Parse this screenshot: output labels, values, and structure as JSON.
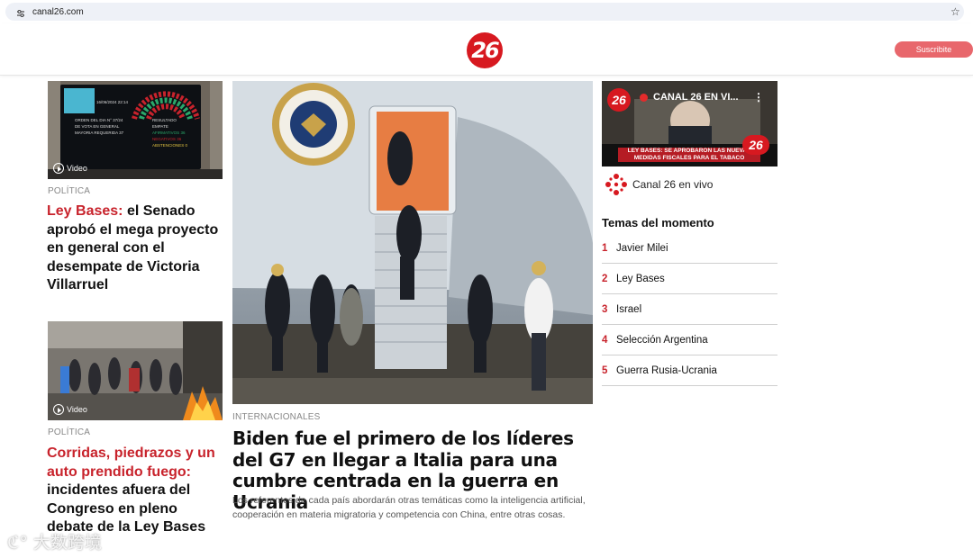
{
  "browser": {
    "url": "canal26.com"
  },
  "header": {
    "logo_text": "26",
    "subscribe_label": "Suscribite"
  },
  "left_cards": [
    {
      "video_label": "Video",
      "section": "POLÍTICA",
      "headline_red": "Ley Bases:",
      "headline_rest": " el Senado aprobó el mega proyecto en general con el desempate de Victoria Villarruel",
      "screen_lines": [
        "16/06/2024 22:14",
        "ORDEN DEL DIA N° 37/24",
        "DE VOTA EN GENERAL",
        "MAYORIA REQUERIDA 37",
        "RESULTADO",
        "EMPATE",
        "AFIRMATIVOS",
        "NEGATIVOS",
        "ABSTENCIONES",
        "36",
        "36",
        "0"
      ]
    },
    {
      "video_label": "Video",
      "section": "POLÍTICA",
      "headline_red": "Corridas, piedrazos y un auto prendido fuego:",
      "headline_rest": " incidentes afuera del Congreso en pleno debate de la Ley Bases"
    }
  ],
  "main_story": {
    "section": "INTERNACIONALES",
    "headline": "Biden fue el primero de los líderes del G7 en llegar a Italia para una cumbre centrada en la guerra en Ucrania",
    "excerpt": "Los referentes de cada país abordarán otras temáticas como la inteligencia artificial, cooperación en materia migratoria y competencia con China, entre otras cosas."
  },
  "live": {
    "channel_title": "CANAL 26 EN VI...",
    "banner_line1": "LEY BASES: SE APROBARON LAS NUEVAS",
    "banner_line2": "MEDIDAS FISCALES PARA EL TABACO",
    "label": "Canal 26 en vivo"
  },
  "trending": {
    "title": "Temas del momento",
    "items": [
      {
        "num": "1",
        "label": "Javier Milei"
      },
      {
        "num": "2",
        "label": "Ley Bases"
      },
      {
        "num": "3",
        "label": "Israel"
      },
      {
        "num": "4",
        "label": "Selección Argentina"
      },
      {
        "num": "5",
        "label": "Guerra Rusia-Ucrania"
      }
    ]
  },
  "watermark": "大数跨境"
}
